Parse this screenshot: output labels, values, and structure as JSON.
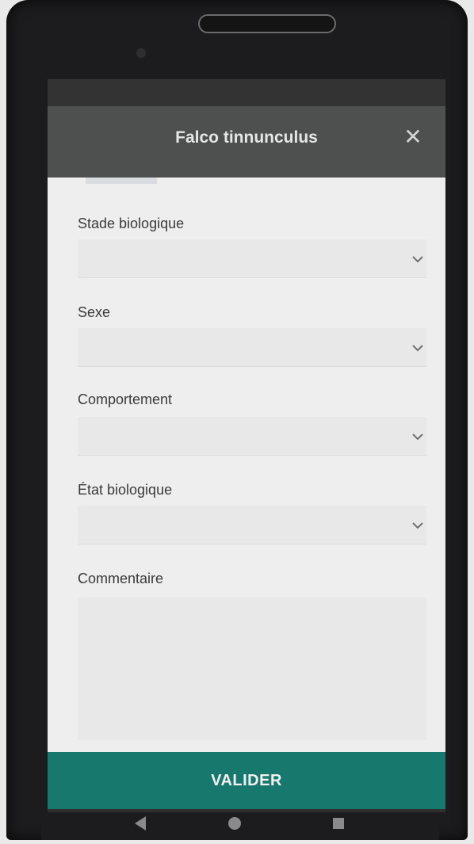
{
  "dialog": {
    "title": "Falco tinnunculus",
    "close_icon": "close-icon"
  },
  "fields": {
    "stade_biologique": {
      "label": "Stade biologique",
      "value": ""
    },
    "sexe": {
      "label": "Sexe",
      "value": ""
    },
    "comportement": {
      "label": "Comportement",
      "value": ""
    },
    "etat_biologique": {
      "label": "État biologique",
      "value": ""
    },
    "commentaire": {
      "label": "Commentaire",
      "value": ""
    }
  },
  "actions": {
    "validate_label": "VALIDER"
  },
  "colors": {
    "app_bar": "#4e4f4f",
    "form_background": "#eeeeee",
    "accent": "#17786e"
  },
  "icons": {
    "dropdown": "chevron-down-icon",
    "nav_back": "nav-back-icon",
    "nav_home": "nav-home-icon",
    "nav_recents": "nav-recents-icon"
  }
}
